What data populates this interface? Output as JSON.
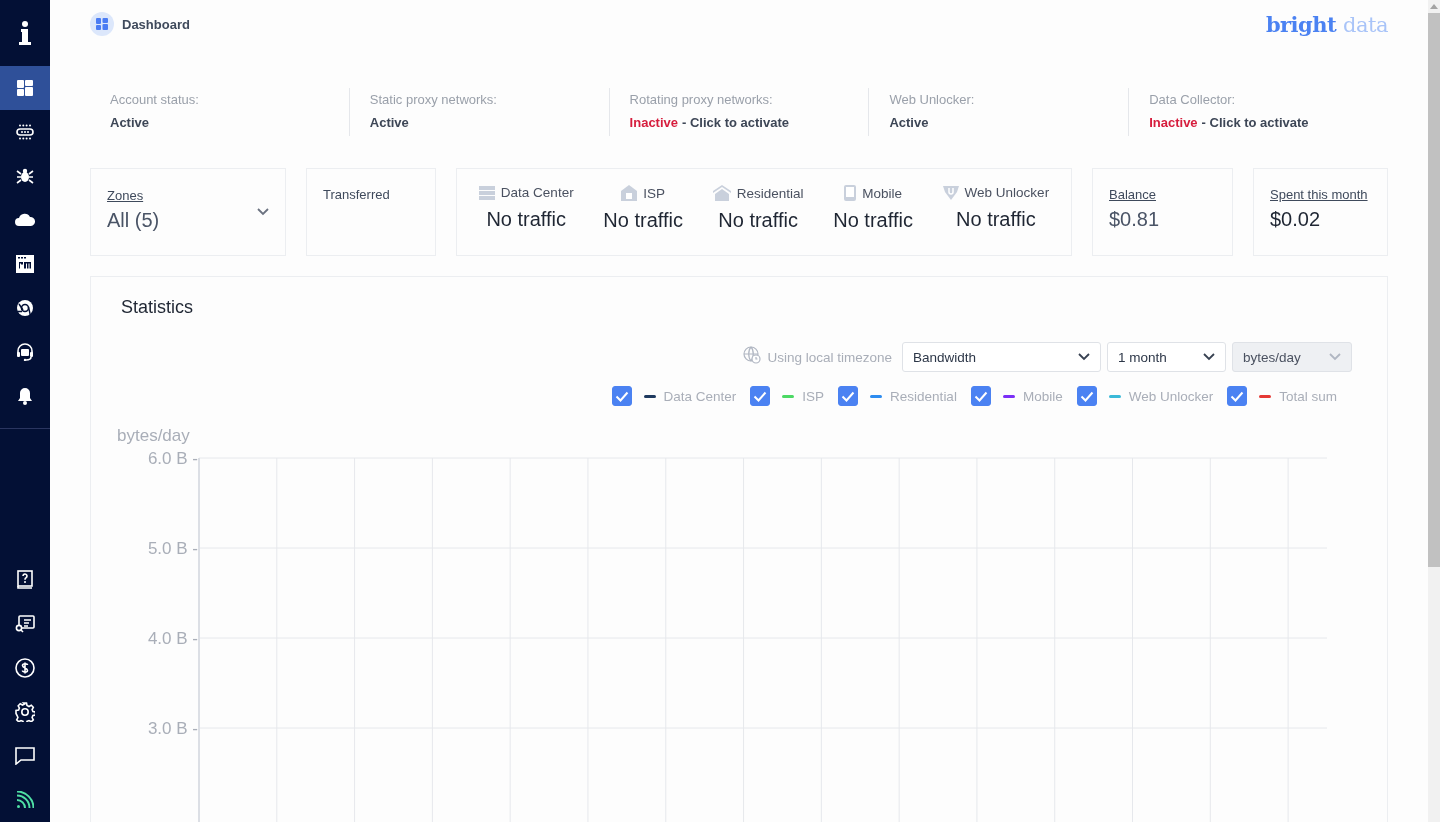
{
  "sidebar": {
    "items": [
      {
        "selected": true
      },
      {
        "selected": false
      },
      {
        "selected": false
      },
      {
        "selected": false
      },
      {
        "selected": false
      },
      {
        "selected": false
      },
      {
        "selected": false
      },
      {
        "selected": false
      }
    ]
  },
  "header": {
    "title": "Dashboard",
    "logo": {
      "word_1": "bright",
      "word_2": "data"
    }
  },
  "statuses": [
    {
      "label": "Account status:",
      "value": "Active",
      "active": true
    },
    {
      "label": "Static proxy networks:",
      "value": "Active",
      "active": true
    },
    {
      "label": "Rotating proxy networks:",
      "value": "Inactive",
      "active": false,
      "action": "- Click to activate"
    },
    {
      "label": "Web Unlocker:",
      "value": "Active",
      "active": true
    },
    {
      "label": "Data Collector:",
      "value": "Inactive",
      "active": false,
      "action": "- Click to activate"
    }
  ],
  "zones": {
    "label": "Zones",
    "value": "All (5)"
  },
  "transferred": {
    "label": "Transferred"
  },
  "traffic": [
    {
      "kind": "datacenter",
      "label": "Data Center",
      "value": "No traffic"
    },
    {
      "kind": "isp",
      "label": "ISP",
      "value": "No traffic"
    },
    {
      "kind": "residential",
      "label": "Residential",
      "value": "No traffic"
    },
    {
      "kind": "mobile",
      "label": "Mobile",
      "value": "No traffic"
    },
    {
      "kind": "unlocker",
      "label": "Web Unlocker",
      "value": "No traffic"
    }
  ],
  "balance": {
    "label": "Balance",
    "value": "$0.81"
  },
  "spent": {
    "label": "Spent this month",
    "value": "$0.02"
  },
  "statistics": {
    "title": "Statistics",
    "timezone": "Using local timezone",
    "selects": [
      {
        "value": "Bandwidth",
        "disabled": false
      },
      {
        "value": "1 month",
        "disabled": false
      },
      {
        "value": "bytes/day",
        "disabled": true
      }
    ],
    "legend": [
      {
        "name": "Data Center",
        "checked": true,
        "color": "#1f3a5f"
      },
      {
        "name": "ISP",
        "checked": true,
        "color": "#4cd964"
      },
      {
        "name": "Residential",
        "checked": true,
        "color": "#2d8cf0"
      },
      {
        "name": "Mobile",
        "checked": true,
        "color": "#7b2ff7"
      },
      {
        "name": "Web Unlocker",
        "checked": true,
        "color": "#3bb9d8"
      },
      {
        "name": "Total sum",
        "checked": true,
        "color": "#e53935"
      }
    ],
    "y_axis": {
      "title": "bytes/day",
      "ticks": [
        "6.0 B -",
        "5.0 B -",
        "4.0 B -",
        "3.0 B -"
      ]
    }
  }
}
